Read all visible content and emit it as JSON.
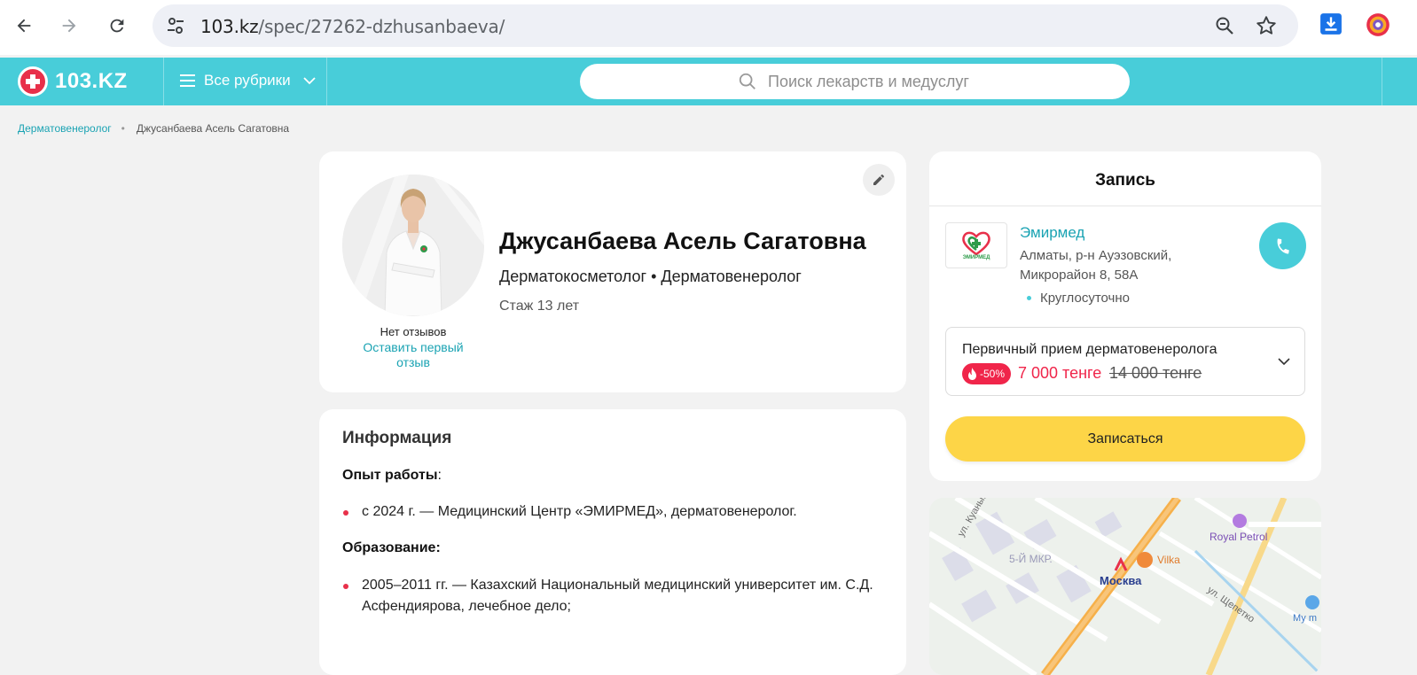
{
  "browser": {
    "url_host": "103.kz",
    "url_path": "/spec/27262-dzhusanbaeva/",
    "icons": [
      "back-arrow-icon",
      "forward-arrow-icon",
      "reload-icon",
      "site-settings-icon",
      "zoom-icon",
      "bookmark-star-icon",
      "download-icon",
      "extension-icon"
    ]
  },
  "header": {
    "logo_text": "103.KZ",
    "rubrics_label": "Все рубрики",
    "search_placeholder": "Поиск лекарств и медуслуг",
    "colors": {
      "bar": "#48cdd9",
      "logo": "#e8304a"
    }
  },
  "breadcrumb": {
    "parent": "Дерматовенеролог",
    "separator": "•",
    "current": "Джусанбаева Асель Сагатовна"
  },
  "profile": {
    "no_reviews": "Нет отзывов",
    "leave_review": "Оставить первый отзыв",
    "name": "Джусанбаева Асель Сагатовна",
    "specialties": "Дерматокосметолог • Дерматовенеролог",
    "experience": "Стаж 13 лет"
  },
  "info": {
    "title": "Информация",
    "work_heading": "Опыт работы",
    "work_colon": ":",
    "work_items": [
      "с 2024 г. — Медицинский Центр «ЭМИРМЕД», дерматовенеролог."
    ],
    "education_heading": "Образование:",
    "education_items": [
      "2005–2011 гг. — Казахский Национальный медицинский университет им. С.Д. Асфендиярова, лечебное дело;"
    ]
  },
  "appointment": {
    "title": "Запись",
    "clinic_logo_text": "ЭМИРМЕД",
    "clinic_name": "Эмирмед",
    "clinic_address": "Алматы, р-н Ауэзовский, Микрорайон 8, 58А",
    "clinic_hours": "Круглосуточно",
    "service_name": "Первичный прием дерматовенеролога",
    "discount": "-50%",
    "price_new": "7 000 тенге",
    "price_old": "14 000 тенге",
    "book_label": "Записаться",
    "colors": {
      "accent": "#48cdd9",
      "discount": "#f0254a",
      "book_button": "#fdd547"
    }
  },
  "map": {
    "labels": [
      "ул. Куанышбае",
      "5-Й МКР.",
      "Москва",
      "Vilka",
      "Royal Petrol",
      "ул. Щепетко",
      "Му m"
    ]
  }
}
